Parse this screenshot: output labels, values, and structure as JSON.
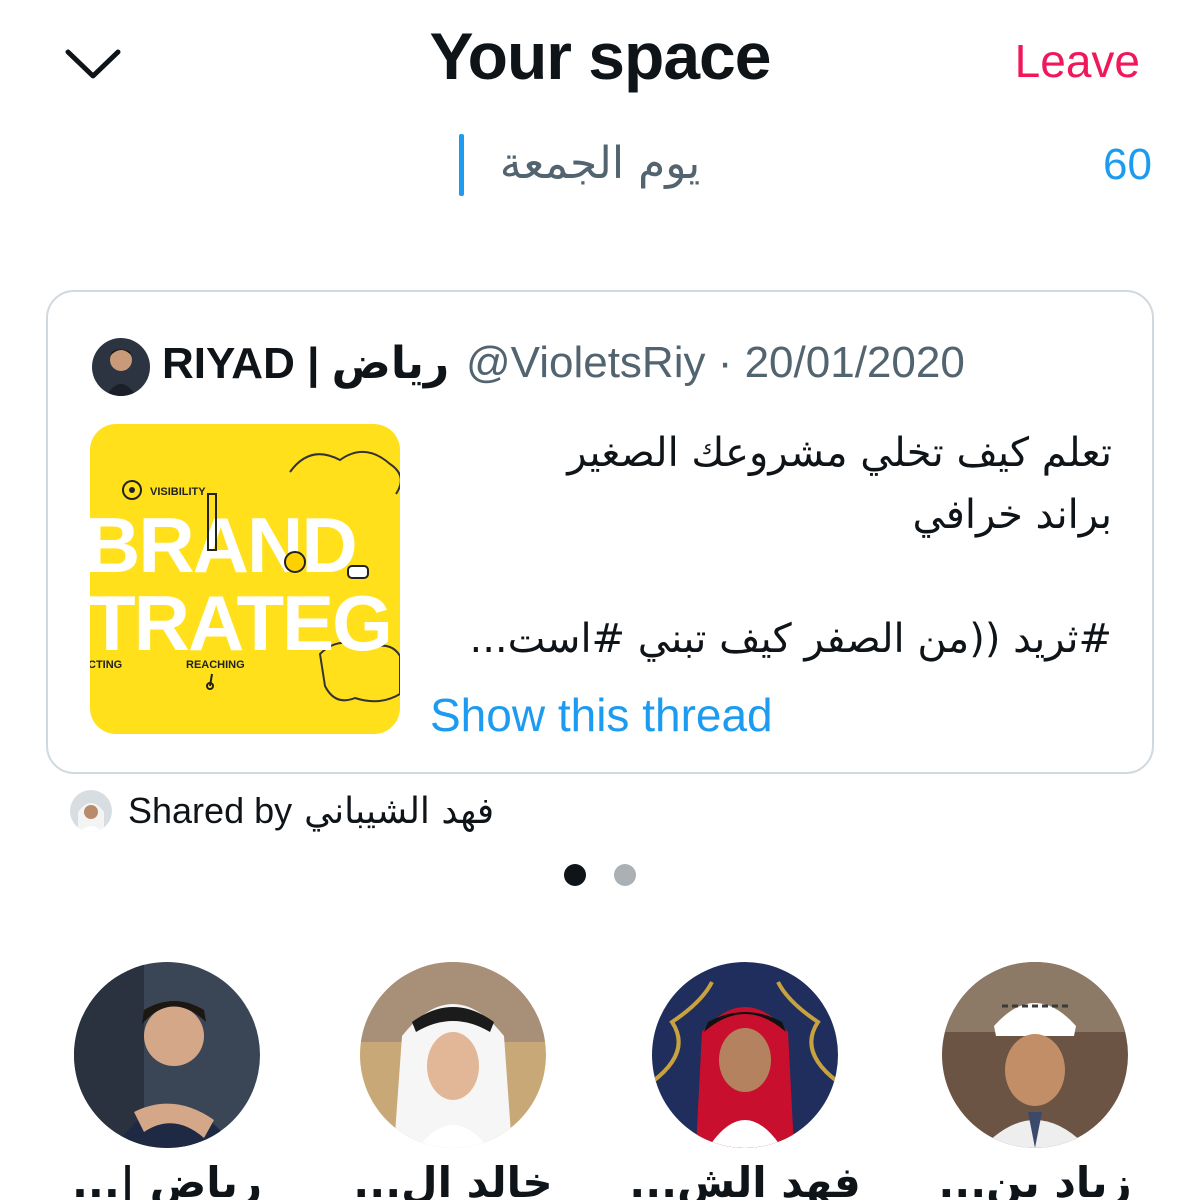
{
  "header": {
    "title": "Your space",
    "leave_label": "Leave",
    "collapse_icon": "chevron-down-icon"
  },
  "topic": {
    "value": "يوم الجمعة",
    "counter": "60"
  },
  "tweet": {
    "author_name": "RIYAD | رياض",
    "author_handle": "@VioletsRiy · 20/01/2020",
    "lines": [
      "تعلم كيف تخلي مشروعك الصغير",
      "براند خرافي",
      "",
      "#ثريد ((من الصفر كيف تبني #است..."
    ],
    "show_thread_label": "Show this thread",
    "thumbnail": {
      "line1": "BRAND",
      "line2": "TRATEG",
      "tag1": "VISIBILITY",
      "tag2": "REACHING",
      "tag3": "CTING"
    }
  },
  "shared": {
    "label": "Shared by",
    "name": "فهد الشيباني"
  },
  "pager": {
    "count": 2,
    "active": 0
  },
  "speakers": [
    {
      "name": "رياض |..."
    },
    {
      "name": "خالد ال..."
    },
    {
      "name": "فهد الش..."
    },
    {
      "name": "زياد بن..."
    }
  ],
  "colors": {
    "accent": "#1d9bf0",
    "leave": "#f0185a",
    "thumb_bg": "#ffe01b"
  }
}
